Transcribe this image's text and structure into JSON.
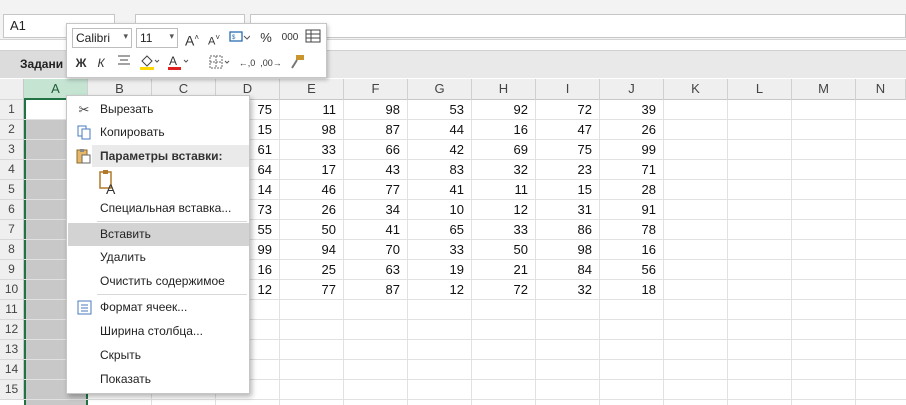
{
  "namebox": {
    "value": "A1"
  },
  "workbook_tab": {
    "label": "Задани"
  },
  "columns": [
    "A",
    "B",
    "C",
    "D",
    "E",
    "F",
    "G",
    "H",
    "I",
    "J",
    "K",
    "L",
    "M",
    "N"
  ],
  "rows": [
    "1",
    "2",
    "3",
    "4",
    "5",
    "6",
    "7",
    "8",
    "9",
    "10",
    "11",
    "12",
    "13",
    "14",
    "15"
  ],
  "data_columns": [
    "D",
    "E",
    "F",
    "G",
    "H",
    "I",
    "J"
  ],
  "table": [
    [
      75,
      11,
      98,
      53,
      92,
      72,
      39
    ],
    [
      15,
      98,
      87,
      44,
      16,
      47,
      26
    ],
    [
      61,
      33,
      66,
      42,
      69,
      75,
      99
    ],
    [
      64,
      17,
      43,
      83,
      32,
      23,
      71
    ],
    [
      14,
      46,
      77,
      41,
      11,
      15,
      28
    ],
    [
      73,
      26,
      34,
      10,
      12,
      31,
      91
    ],
    [
      55,
      50,
      41,
      65,
      33,
      86,
      78
    ],
    [
      99,
      94,
      70,
      33,
      50,
      98,
      16
    ],
    [
      16,
      25,
      63,
      19,
      21,
      84,
      56
    ],
    [
      12,
      77,
      87,
      12,
      72,
      32,
      18
    ]
  ],
  "mini_toolbar": {
    "font": "Calibri",
    "size": "11",
    "bold": "Ж",
    "italic": "К",
    "percent": "%",
    "thousands": "000"
  },
  "context_menu": {
    "cut": "Вырезать",
    "copy": "Копировать",
    "paste_options_header": "Параметры вставки:",
    "paste_special": "Специальная вставка...",
    "insert": "Вставить",
    "delete": "Удалить",
    "clear_contents": "Очистить содержимое",
    "format_cells": "Формат ячеек...",
    "column_width": "Ширина столбца...",
    "hide": "Скрыть",
    "unhide": "Показать"
  },
  "colors": {
    "accent": "#217346",
    "hover": "#d3d3d3"
  }
}
